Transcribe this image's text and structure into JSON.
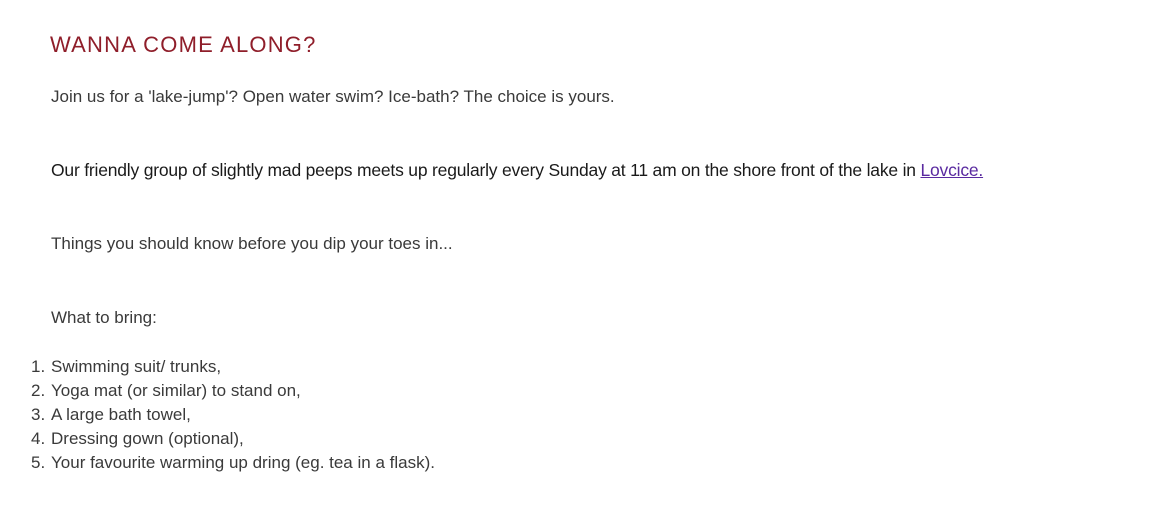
{
  "heading": "WANNA COME ALONG?",
  "intro": "Join us for a 'lake-jump'? Open water swim? Ice-bath? The choice is yours.",
  "meetup": {
    "text": "Our friendly group of slightly mad peeps meets up regularly every Sunday at 11 am on the shore front of the lake in ",
    "link_label": "Lovcice."
  },
  "things_note": "Things you should know before you dip your toes in...",
  "bring_title": "What to bring:",
  "bring_list": [
    {
      "num": "1.",
      "text": "Swimming suit/ trunks,"
    },
    {
      "num": "2.",
      "text": "Yoga mat (or similar) to stand on,"
    },
    {
      "num": "3.",
      "text": "A large bath towel,"
    },
    {
      "num": "4.",
      "text": "Dressing gown (optional),"
    },
    {
      "num": "5.",
      "text": "Your favourite warming up dring (eg. tea in a flask)."
    }
  ],
  "colors": {
    "heading": "#8f1e2a",
    "link": "#5a2aa0",
    "text": "#3a3a3a"
  }
}
